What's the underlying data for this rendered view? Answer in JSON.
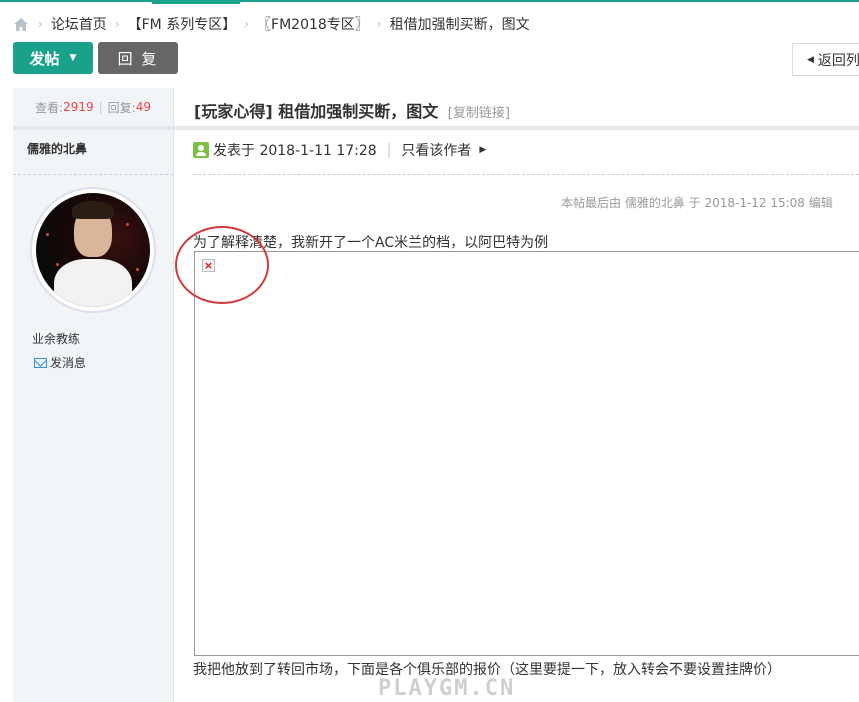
{
  "breadcrumb": {
    "items": [
      "论坛首页",
      "【FM 系列专区】",
      "〖FM2018专区〗",
      "租借加强制买断，图文"
    ],
    "separator": "›"
  },
  "toolbar": {
    "post_label": "发帖",
    "reply_label": "回 复",
    "back_label": "返回列"
  },
  "stats": {
    "views_label": "查看:",
    "views": "2919",
    "replies_label": "回复:",
    "replies": "49"
  },
  "author": {
    "name": "儒雅的北鼻",
    "rank": "业余教练",
    "message_label": "发消息"
  },
  "thread": {
    "title": "[玩家心得] 租借加强制买断，图文",
    "copy_link": "[复制链接]"
  },
  "post": {
    "posted_at": "发表于 2018-1-11 17:28",
    "only_author": "只看该作者",
    "edited_note": "本帖最后由 儒雅的北鼻 于 2018-1-12 15:08 编辑",
    "para1": "为了解释清楚，我新开了一个AC米兰的档，以阿巴特为例",
    "para2": "我把他放到了转回市场，下面是各个俱乐部的报价（这里要提一下，放入转会不要设置挂牌价）"
  },
  "watermark": "PLAYGM.CN",
  "colors": {
    "accent": "#19a18c",
    "reply_button": "#666666",
    "stat_number": "#ee4444",
    "annotation_circle": "#d13a3a"
  }
}
